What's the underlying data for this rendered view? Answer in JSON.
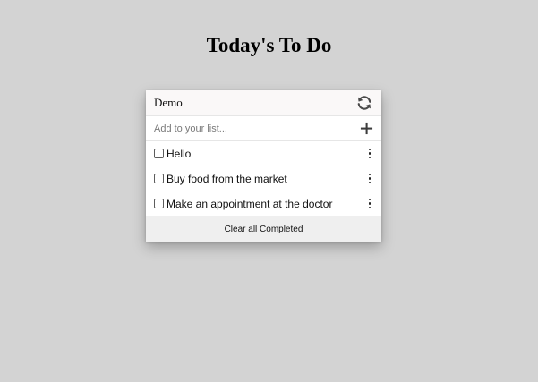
{
  "page": {
    "title": "Today's To Do"
  },
  "card": {
    "list_title": "Demo",
    "refresh_icon": "refresh-icon",
    "add": {
      "placeholder": "Add to your list...",
      "value": "",
      "icon": "plus-icon"
    },
    "items": [
      {
        "text": "Hello",
        "checked": false,
        "menu_icon": "more-vertical-icon"
      },
      {
        "text": "Buy food from the market",
        "checked": false,
        "menu_icon": "more-vertical-icon"
      },
      {
        "text": "Make an appointment at the doctor",
        "checked": false,
        "menu_icon": "more-vertical-icon"
      }
    ],
    "footer_label": "Clear all Completed"
  },
  "colors": {
    "background": "#d3d3d3",
    "card": "#ffffff",
    "footer": "#efefef"
  }
}
